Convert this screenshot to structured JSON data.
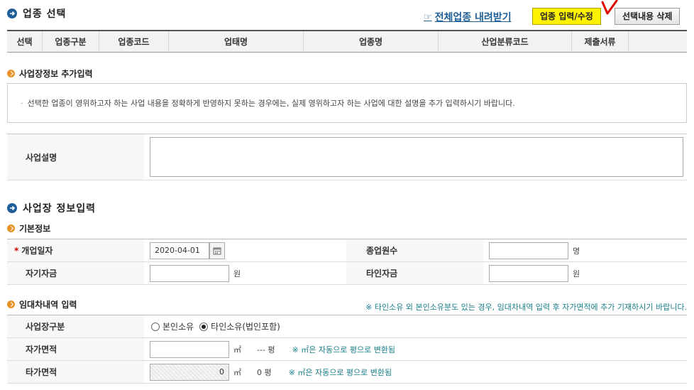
{
  "industry_section": {
    "title": "업종 선택",
    "download_label": "전체업종 내려받기",
    "input_button": "업종 입력/수정",
    "delete_button": "선택내용 삭제",
    "columns": [
      "선택",
      "업종구분",
      "업종코드",
      "업태명",
      "업종명",
      "산업분류코드",
      "제출서류"
    ]
  },
  "extra_info": {
    "title": "사업장정보 추가입력",
    "notice": "선택한 업종이 영위하고자 하는 사업 내용을 정확하게 반영하지 못하는 경우에는, 실제 영위하고자 하는 사업에 대한 설명을 추가 입력하시기 바랍니다.",
    "desc_label": "사업설명",
    "desc_value": ""
  },
  "business_section": {
    "title": "사업장 정보입력",
    "basic": {
      "title": "기본정보",
      "open_date_label": "개업일자",
      "open_date_value": "2020-04-01",
      "employees_label": "종업원수",
      "employees_value": "",
      "employees_unit": "명",
      "own_capital_label": "자기자금",
      "own_capital_value": "",
      "own_capital_unit": "원",
      "other_capital_label": "타인자금",
      "other_capital_value": "",
      "other_capital_unit": "원"
    },
    "lease": {
      "title": "임대차내역 입력",
      "note": "※ 타인소유 외 본인소유분도 있는 경우, 임대차내역 입력 후 자가면적에 추가 기재하시기 바랍니다.",
      "type_label": "사업장구분",
      "option_own": "본인소유",
      "option_other": "타인소유(법인포함)",
      "selected": "타인소유(법인포함)",
      "own_area_label": "자가면적",
      "own_area_value": "",
      "area_unit": "㎡",
      "own_pyeong": "--- 평",
      "auto_convert": "※ ㎡은 자동으로 평으로 변환됨",
      "other_area_label": "타가면적",
      "other_area_value": "0",
      "other_pyeong": "0 평"
    }
  },
  "colors": {
    "accent_blue": "#1f5f97",
    "button_yellow": "#fff200",
    "guide_teal": "#1a7f8a",
    "check_mark_red": "#e00000"
  }
}
